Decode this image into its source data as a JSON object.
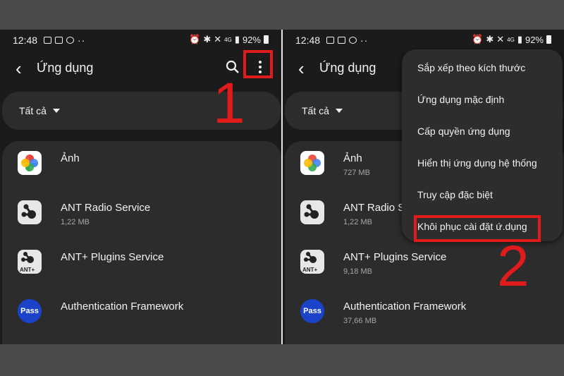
{
  "status_bar": {
    "time": "12:48",
    "battery": "92%",
    "signal_label": "4G"
  },
  "left": {
    "title": "Ứng dụng",
    "filter_label": "Tất cả",
    "step_number": "1",
    "apps": [
      {
        "name": "Ảnh",
        "size": "",
        "icon": "google-photos-icon"
      },
      {
        "name": "ANT Radio Service",
        "size": "1,22 MB",
        "icon": "ant-radio-icon"
      },
      {
        "name": "ANT+ Plugins Service",
        "size": "",
        "icon": "ant-plus-icon",
        "badge": "ANT+"
      },
      {
        "name": "Authentication Framework",
        "size": "",
        "icon": "pass-icon",
        "badge": "Pass"
      }
    ]
  },
  "right": {
    "title": "Ứng dụng",
    "filter_label": "Tất cả",
    "step_number": "2",
    "apps": [
      {
        "name": "Ảnh",
        "size": "727 MB",
        "icon": "google-photos-icon"
      },
      {
        "name": "ANT Radio S",
        "size": "1,22 MB",
        "icon": "ant-radio-icon"
      },
      {
        "name": "ANT+ Plugins Service",
        "size": "9,18 MB",
        "icon": "ant-plus-icon",
        "badge": "ANT+"
      },
      {
        "name": "Authentication Framework",
        "size": "37,66 MB",
        "icon": "pass-icon",
        "badge": "Pass"
      }
    ],
    "menu": [
      "Sắp xếp theo kích thước",
      "Ứng dụng mặc định",
      "Cấp quyền ứng dụng",
      "Hiển thị ứng dụng hệ thống",
      "Truy cập đặc biệt",
      "Khôi phục cài đặt ứ.dụng"
    ]
  },
  "colors": {
    "highlight": "#e01b1b",
    "panel_bg": "#1b1b1b",
    "card_bg": "#2c2c2c"
  }
}
